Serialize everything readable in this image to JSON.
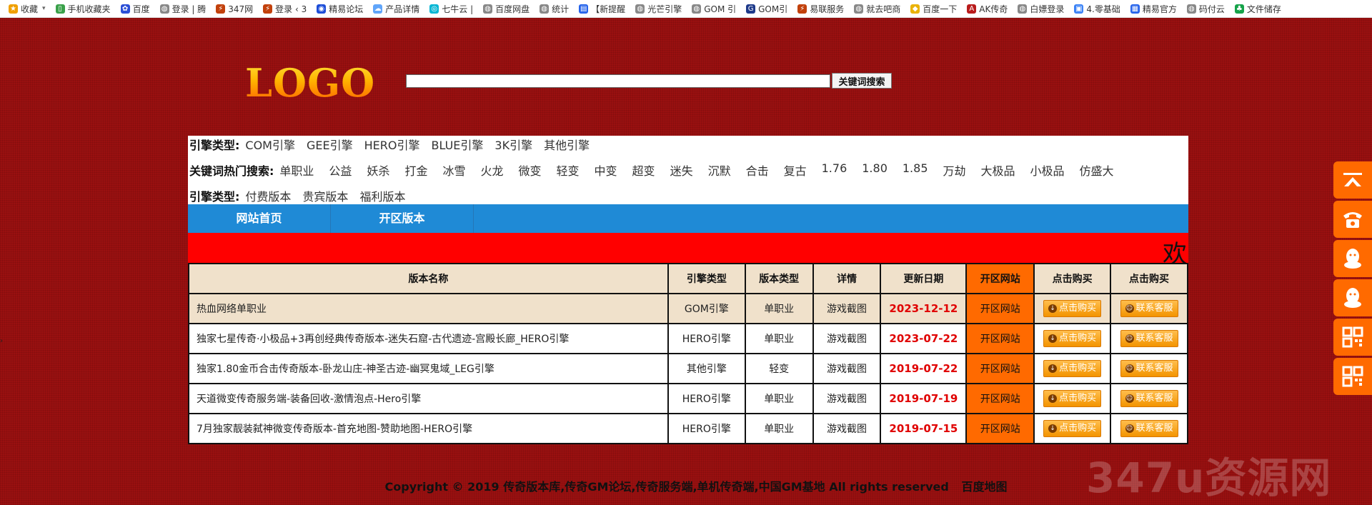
{
  "bookmarks": [
    {
      "icon": "star-icon",
      "label": "收藏",
      "caret": "▾",
      "color": "#f0a000"
    },
    {
      "icon": "phone-icon",
      "label": "手机收藏夹",
      "color": "#3aa14a"
    },
    {
      "icon": "baidu-icon",
      "label": "百度",
      "color": "#2b4fd6"
    },
    {
      "icon": "globe-icon",
      "label": "登录 | 腾",
      "color": "#888888"
    },
    {
      "icon": "brand-347-icon",
      "label": "347网",
      "color": "#c2410c"
    },
    {
      "icon": "brand-347-icon",
      "label": "登录 ‹ 3",
      "color": "#c2410c"
    },
    {
      "icon": "eye-icon",
      "label": "精易论坛",
      "color": "#1d4ed8"
    },
    {
      "icon": "cloud-icon",
      "label": "产品详情",
      "color": "#60a5fa"
    },
    {
      "icon": "qiniu-icon",
      "label": "七牛云 |",
      "color": "#06b6d4"
    },
    {
      "icon": "globe-icon",
      "label": "百度网盘",
      "color": "#888888"
    },
    {
      "icon": "globe-icon",
      "label": "统计",
      "color": "#888888"
    },
    {
      "icon": "doc-icon",
      "label": "【新提醒",
      "color": "#2563eb"
    },
    {
      "icon": "globe-icon",
      "label": "光芒引擎",
      "color": "#888888"
    },
    {
      "icon": "globe-icon",
      "label": "GOM 引",
      "color": "#888888"
    },
    {
      "icon": "gom-icon",
      "label": "GOM引",
      "color": "#1e3a8a"
    },
    {
      "icon": "brand-347-icon",
      "label": "易联服务",
      "color": "#c2410c"
    },
    {
      "icon": "globe-icon",
      "label": "就去吧商",
      "color": "#888888"
    },
    {
      "icon": "shield-icon",
      "label": "百度一下",
      "color": "#eab308"
    },
    {
      "icon": "ak-icon",
      "label": "AK传奇",
      "color": "#b91c1c"
    },
    {
      "icon": "globe-icon",
      "label": "白嫖登录",
      "color": "#888888"
    },
    {
      "icon": "bilibili-icon",
      "label": "4.零基础",
      "color": "#3b82f6"
    },
    {
      "icon": "calendar-icon",
      "label": "精易官方",
      "color": "#2563eb"
    },
    {
      "icon": "globe-icon",
      "label": "码付云",
      "color": "#888888"
    },
    {
      "icon": "tree-icon",
      "label": "文件储存",
      "color": "#16a34a"
    }
  ],
  "header": {
    "logo_text": "LOGO",
    "search_value": "",
    "search_button": "关键词搜索"
  },
  "filters": {
    "engine_label": "引擎类型:",
    "engine_options": [
      "COM引擎",
      "GEE引擎",
      "HERO引擎",
      "BLUE引擎",
      "3K引擎",
      "其他引擎"
    ],
    "hot_label": "关键词热门搜索:",
    "hot_options": [
      "单职业",
      "公益",
      "妖杀",
      "打金",
      "冰雪",
      "火龙",
      "微变",
      "轻变",
      "中变",
      "超变",
      "迷失",
      "沉默",
      "合击",
      "复古",
      "1.76",
      "1.80",
      "1.85",
      "万劫",
      "大极品",
      "小极品",
      "仿盛大"
    ],
    "version_label": "引擎类型:",
    "version_options": [
      "付费版本",
      "贵宾版本",
      "福利版本"
    ]
  },
  "nav": {
    "items": [
      "网站首页",
      "开区版本"
    ]
  },
  "marquee": {
    "text": "欢"
  },
  "table": {
    "headers": [
      "版本名称",
      "引擎类型",
      "版本类型",
      "详情",
      "更新日期",
      "开区网站",
      "点击购买",
      "点击购买"
    ],
    "rows": [
      {
        "name": "热血网络单职业",
        "engine": "GOM引擎",
        "type": "单职业",
        "detail": "游戏截图",
        "date": "2023-12-12",
        "site": "开区网站",
        "buy": "点击购买",
        "contact": "联系客服"
      },
      {
        "name": "独家七星传奇·小极品+3再创经典传奇版本-迷失石窟-古代遗迹-宫殿长廊_HERO引擎",
        "engine": "HERO引擎",
        "type": "单职业",
        "detail": "游戏截图",
        "date": "2023-07-22",
        "site": "开区网站",
        "buy": "点击购买",
        "contact": "联系客服"
      },
      {
        "name": "独家1.80金币合击传奇版本-卧龙山庄-神圣古迹-幽冥鬼域_LEG引擎",
        "engine": "其他引擎",
        "type": "轻变",
        "detail": "游戏截图",
        "date": "2019-07-22",
        "site": "开区网站",
        "buy": "点击购买",
        "contact": "联系客服"
      },
      {
        "name": "天道微变传奇服务端-装备回收-激情泡点-Hero引擎",
        "engine": "HERO引擎",
        "type": "单职业",
        "detail": "游戏截图",
        "date": "2019-07-19",
        "site": "开区网站",
        "buy": "点击购买",
        "contact": "联系客服"
      },
      {
        "name": "7月独家靓装弑神微变传奇版本-首充地图-赞助地图-HERO引擎",
        "engine": "HERO引擎",
        "type": "单职业",
        "detail": "游戏截图",
        "date": "2019-07-15",
        "site": "开区网站",
        "buy": "点击购买",
        "contact": "联系客服"
      }
    ]
  },
  "footer": {
    "copyright": "Copyright © 2019 传奇版本库,传奇GM论坛,传奇服务端,单机传奇端,中国GM基地 All rights reserved",
    "sitemap_link": "百度地图"
  },
  "watermark": "347u资源网",
  "sidebar": [
    "back-to-top-icon",
    "telephone-icon",
    "qq-penguin-icon",
    "qq-penguin-icon",
    "qr-code-icon",
    "qr-code-icon"
  ],
  "colors": {
    "page_bg": "#9a1010",
    "nav_blue": "#1f8ad6",
    "marquee_red": "#ff0000",
    "accent_orange": "#ff6a00",
    "date_red": "#e00000",
    "header_beige": "#f0e1cb"
  }
}
